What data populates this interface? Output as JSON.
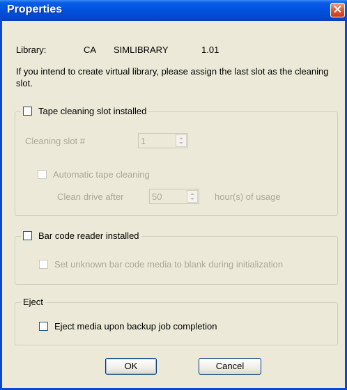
{
  "window": {
    "title": "Properties",
    "close_symbol": "✕"
  },
  "library": {
    "label": "Library:",
    "vendor": "CA",
    "name": "SIMLIBRARY",
    "version": "1.01"
  },
  "note": "If you intend to create virtual library, please assign the last slot as the cleaning slot.",
  "tape_cleaning": {
    "checkbox_label": "Tape cleaning slot installed",
    "checked": false,
    "slot_label": "Cleaning slot #",
    "slot_value": "1",
    "auto_label": "Automatic tape cleaning",
    "clean_after_label": "Clean drive after",
    "hours_value": "50",
    "hours_suffix": "hour(s) of usage"
  },
  "barcode": {
    "checkbox_label": "Bar code reader installed",
    "checked": false,
    "unknown_label": "Set unknown bar code media to blank during initialization"
  },
  "eject": {
    "group_label": "Eject",
    "checkbox_label": "Eject media upon backup job completion",
    "checked": false
  },
  "buttons": {
    "ok": "OK",
    "cancel": "Cancel"
  },
  "colors": {
    "titlebar": "#0052e0",
    "dialog_bg": "#ece9d8",
    "close": "#e0522e",
    "disabled_text": "#aca899"
  }
}
